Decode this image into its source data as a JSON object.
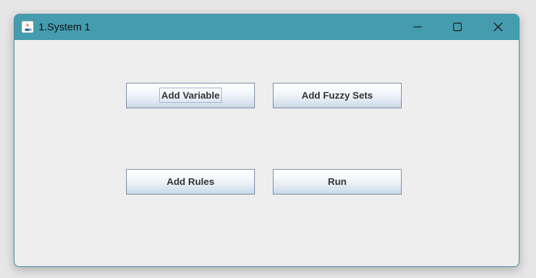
{
  "window": {
    "title": "1.System 1",
    "icon": "java-icon"
  },
  "controls": {
    "minimize_icon": "minimize-icon",
    "maximize_icon": "maximize-icon",
    "close_icon": "close-icon"
  },
  "buttons": {
    "add_variable": "Add Variable",
    "add_fuzzy_sets": "Add Fuzzy Sets",
    "add_rules": "Add Rules",
    "run": "Run"
  },
  "colors": {
    "titlebar": "#459caf",
    "content_background": "#eeeeee",
    "button_border": "#7a8aa4"
  }
}
